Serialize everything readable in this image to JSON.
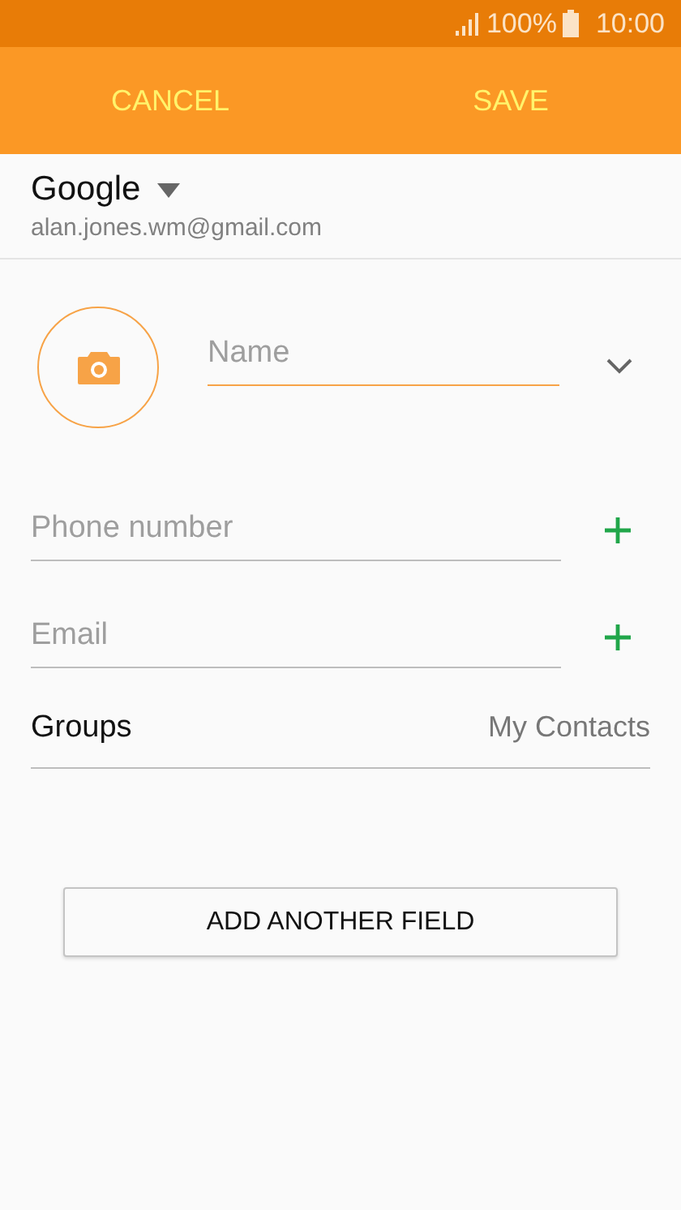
{
  "status_bar": {
    "battery": "100%",
    "time": "10:00"
  },
  "action_bar": {
    "buttons": [
      "CANCEL",
      "SAVE"
    ]
  },
  "account": {
    "type": "Google",
    "email": "alan.jones.wm@gmail.com"
  },
  "name_field": {
    "placeholder": "Name",
    "focused": true
  },
  "fields": [
    {
      "placeholder": "Phone number"
    },
    {
      "placeholder": "Email"
    }
  ],
  "groups": {
    "label": "Groups",
    "value": "My Contacts"
  },
  "add_button": "ADD ANOTHER FIELD"
}
